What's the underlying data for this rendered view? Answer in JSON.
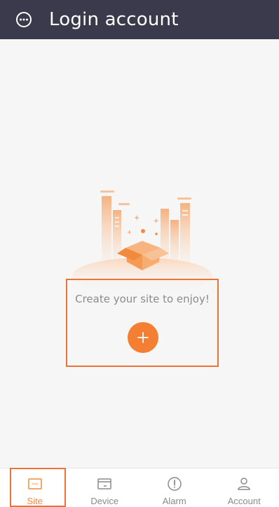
{
  "header": {
    "title": "Login account",
    "menu_icon": "more-circle-icon",
    "background": "#3a3a4c"
  },
  "empty_state": {
    "message": "Create your site to enjoy!",
    "illustration": "open-box-city-illustration",
    "add_icon": "plus-icon",
    "accent": "#f47f32"
  },
  "tabbar": {
    "active": "Site",
    "active_color": "#f08a3c",
    "items": [
      {
        "label": "Site",
        "icon": "site-icon"
      },
      {
        "label": "Device",
        "icon": "device-icon"
      },
      {
        "label": "Alarm",
        "icon": "alarm-icon"
      },
      {
        "label": "Account",
        "icon": "account-icon"
      }
    ]
  }
}
